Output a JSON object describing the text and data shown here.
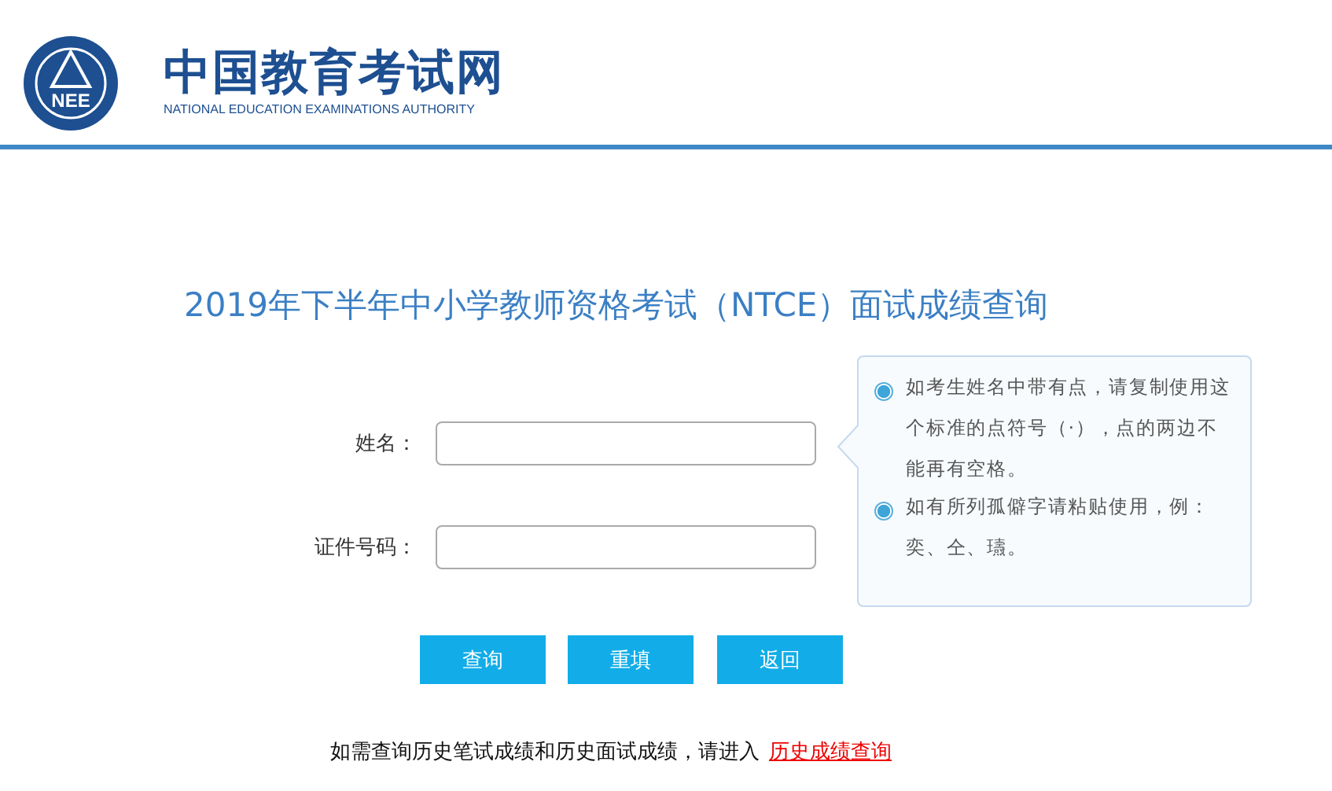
{
  "header": {
    "logo_mark": "NEE",
    "site_name": "中国教育考试网",
    "site_name_en": "NATIONAL EDUCATION EXAMINATIONS AUTHORITY"
  },
  "title": "2019年下半年中小学教师资格考试（NTCE）面试成绩查询",
  "fields": [
    {
      "label": "姓名："
    },
    {
      "label": "证件号码："
    }
  ],
  "tips": [
    {
      "text": "如考生姓名中带有点，请复制使用这个标准的点符号（·），点的两边不能再有空格。",
      "selected": true
    },
    {
      "text": "如有所列孤僻字请粘贴使用，例：奕、仝、瓙。",
      "selected": true
    }
  ],
  "buttons": [
    "查询",
    "重填",
    "返回"
  ],
  "footer": {
    "text": "如需查询历史笔试成绩和历史面试成绩，请进入",
    "link": "历史成绩查询"
  }
}
